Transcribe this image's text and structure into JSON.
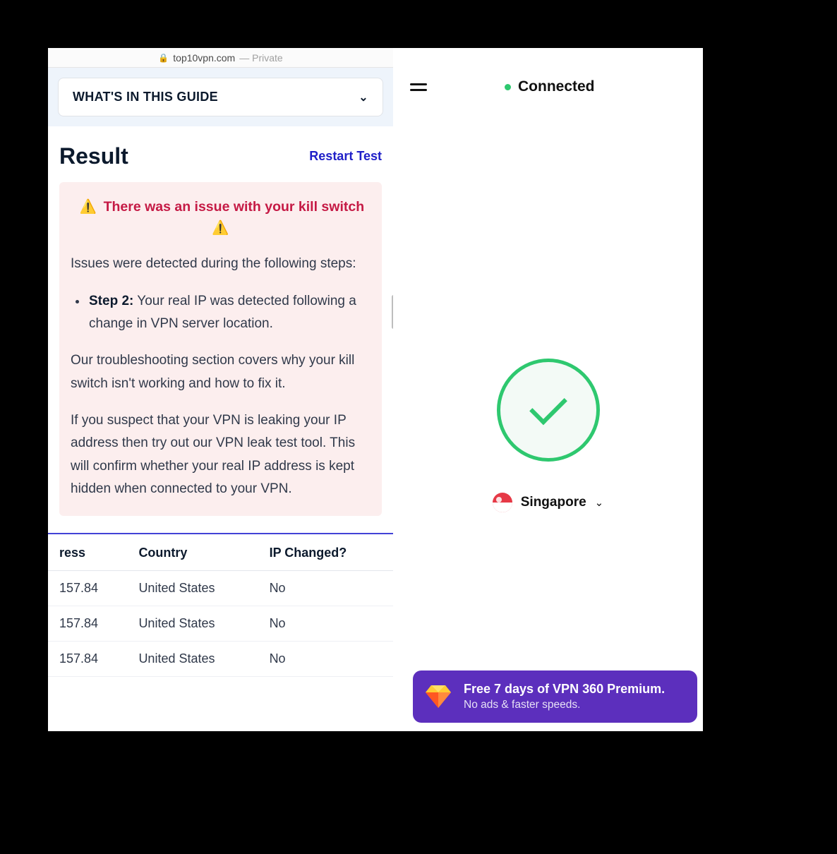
{
  "browser": {
    "domain": "top10vpn.com",
    "private_label": " — Private"
  },
  "guide": {
    "title": "WHAT'S IN THIS GUIDE"
  },
  "result": {
    "heading": "Result",
    "restart": "Restart Test",
    "alert_title": "There was an issue with your kill switch",
    "intro": "Issues were detected during the following steps:",
    "step_label": "Step 2:",
    "step_text": " Your real IP was detected following a change in VPN server location.",
    "para2": "Our troubleshooting section covers why your kill switch isn't working and how to fix it.",
    "para3": "If you suspect that your VPN is leaking your IP address then try out our VPN leak test tool. This will confirm whether your real IP address is kept hidden when connected to your VPN."
  },
  "table": {
    "cols": [
      "ress",
      "Country",
      "IP Changed?"
    ],
    "rows": [
      {
        "ip": "157.84",
        "country": "United States",
        "changed": "No"
      },
      {
        "ip": "157.84",
        "country": "United States",
        "changed": "No"
      },
      {
        "ip": "157.84",
        "country": "United States",
        "changed": "No"
      }
    ]
  },
  "app": {
    "status": "Connected",
    "location": "Singapore"
  },
  "promo": {
    "title": "Free 7 days of VPN 360 Premium.",
    "subtitle": "No ads & faster speeds."
  }
}
